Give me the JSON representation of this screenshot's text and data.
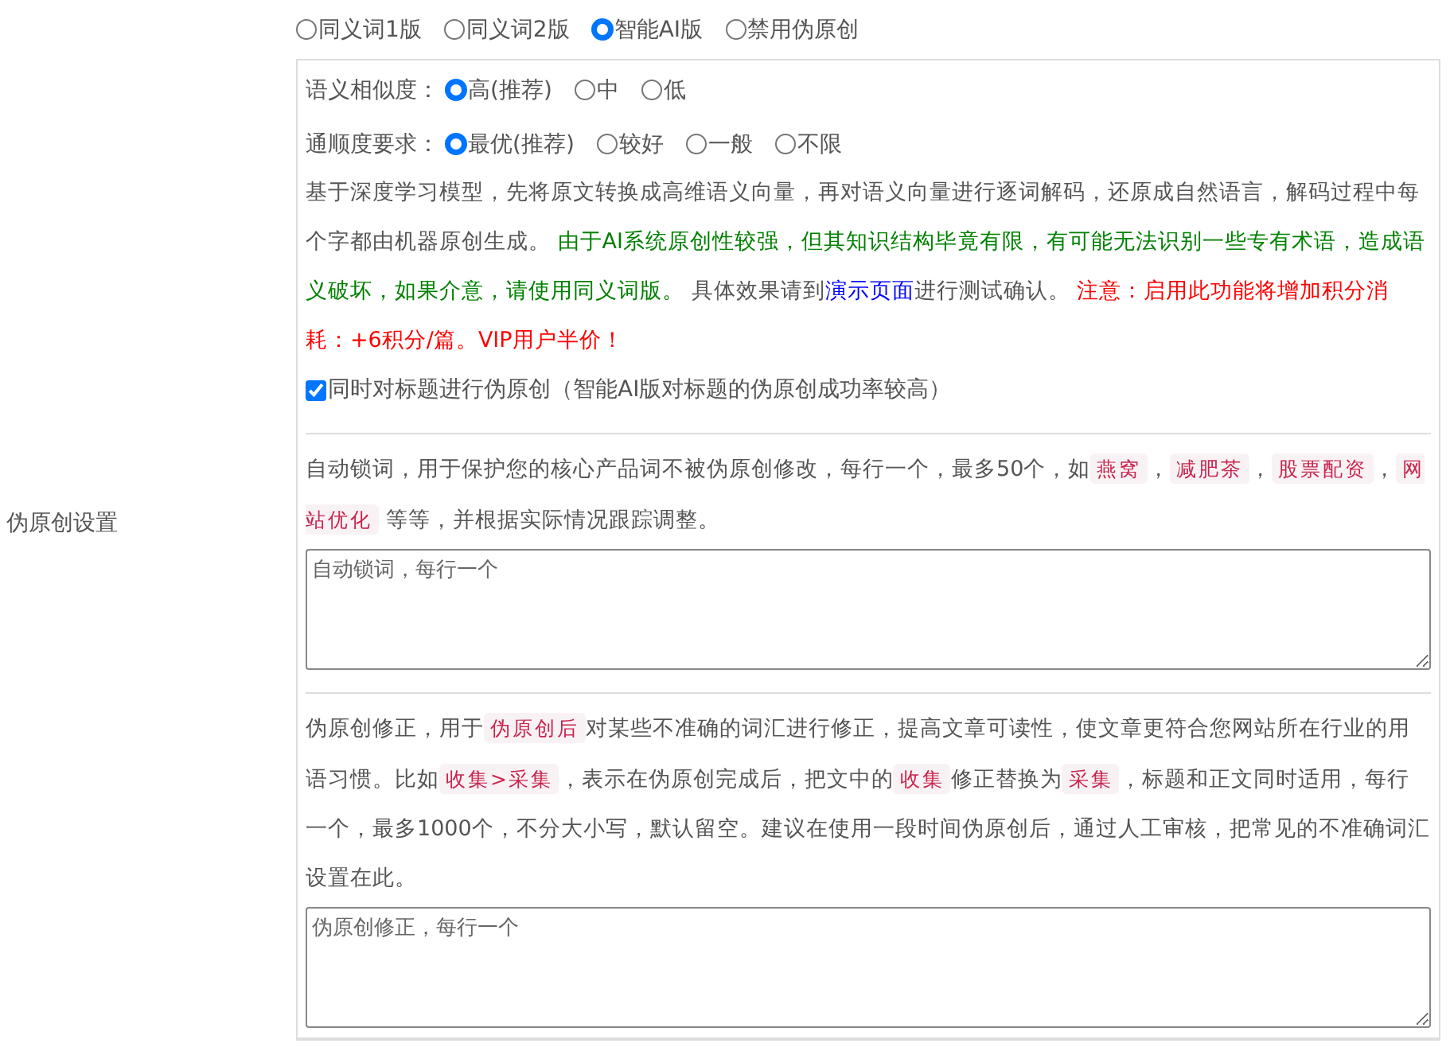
{
  "sidebar_label": "伪原创设置",
  "modes": [
    {
      "label": "同义词1版",
      "selected": false
    },
    {
      "label": "同义词2版",
      "selected": false
    },
    {
      "label": "智能AI版",
      "selected": true
    },
    {
      "label": "禁用伪原创",
      "selected": false
    }
  ],
  "ai_settings": {
    "option_groups": [
      {
        "label": "语义相似度：",
        "options": [
          {
            "label": "高(推荐)",
            "selected": true
          },
          {
            "label": "中",
            "selected": false
          },
          {
            "label": "低",
            "selected": false
          }
        ]
      },
      {
        "label": "通顺度要求：",
        "options": [
          {
            "label": "最优(推荐)",
            "selected": true
          },
          {
            "label": "较好",
            "selected": false
          },
          {
            "label": "一般",
            "selected": false
          },
          {
            "label": "不限",
            "selected": false
          }
        ]
      }
    ],
    "description": [
      {
        "kind": "text",
        "text": "基于深度学习模型，先将原文转换成高维语义向量，再对语义向量进行逐词解码，还原成自然语言，解码过程中每个字都由机器原创生成。 "
      },
      {
        "kind": "green",
        "text": "由于AI系统原创性较强，但其知识结构毕竟有限，有可能无法识别一些专有术语，造成语义破坏，如果介意，请使用同义词版。"
      },
      {
        "kind": "text",
        "text": " 具体效果请到"
      },
      {
        "kind": "link",
        "text": "演示页面"
      },
      {
        "kind": "text",
        "text": "进行测试确认。 "
      },
      {
        "kind": "red",
        "text": "注意：启用此功能将增加积分消耗：+6积分/篇。VIP用户半价！"
      }
    ],
    "title_option": {
      "label": "同时对标题进行伪原创（智能AI版对标题的伪原创成功率较高）",
      "checked": true
    }
  },
  "lock_words": {
    "description": [
      {
        "kind": "text",
        "text": "自动锁词，用于保护您的核心产品词不被伪原创修改，每行一个，最多50个，如"
      },
      {
        "kind": "tag",
        "text": "燕窝"
      },
      {
        "kind": "text",
        "text": "，"
      },
      {
        "kind": "tag",
        "text": "减肥茶"
      },
      {
        "kind": "text",
        "text": "，"
      },
      {
        "kind": "tag",
        "text": "股票配资"
      },
      {
        "kind": "text",
        "text": "，"
      },
      {
        "kind": "tag",
        "text": "网站优化"
      },
      {
        "kind": "text",
        "text": " 等等，并根据实际情况跟踪调整。"
      }
    ],
    "textarea": {
      "placeholder": "自动锁词，每行一个"
    }
  },
  "corrections": {
    "description": [
      {
        "kind": "text",
        "text": "伪原创修正，用于"
      },
      {
        "kind": "tag",
        "text": "伪原创后"
      },
      {
        "kind": "text",
        "text": "对某些不准确的词汇进行修正，提高文章可读性，使文章更符合您网站所在行业的用语习惯。比如"
      },
      {
        "kind": "tag",
        "text": "收集>采集"
      },
      {
        "kind": "text",
        "text": "，表示在伪原创完成后，把文中的"
      },
      {
        "kind": "tag",
        "text": "收集"
      },
      {
        "kind": "text",
        "text": "修正替换为"
      },
      {
        "kind": "tag",
        "text": "采集"
      },
      {
        "kind": "text",
        "text": "，标题和正文同时适用，每行一个，最多1000个，不分大小写，默认留空。建议在使用一段时间伪原创后，通过人工审核，把常见的不准确词汇设置在此。"
      }
    ],
    "textarea": {
      "placeholder": "伪原创修正，每行一个"
    }
  }
}
